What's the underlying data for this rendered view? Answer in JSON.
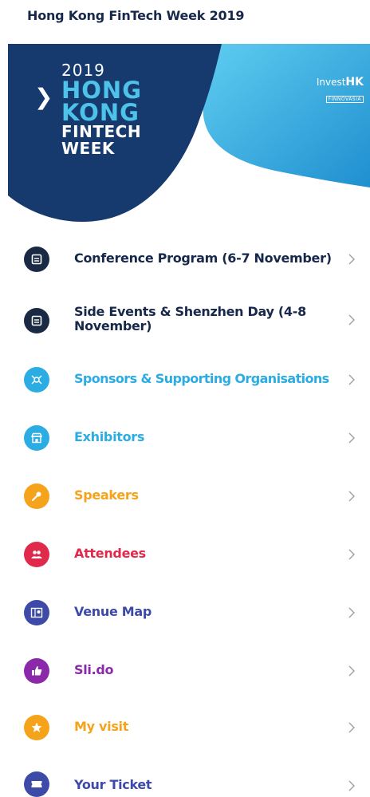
{
  "app_title": "Hong Kong FinTech Week 2019",
  "banner": {
    "year": "2019",
    "line1": "HONG",
    "line2": "KONG",
    "line3": "FINTECH",
    "line4": "WEEK",
    "partner_brand_prefix": "Invest",
    "partner_brand_suffix": "HK",
    "partner_sub": "FINNOVASIA"
  },
  "colors": {
    "navy": "#17284a",
    "dark_icon": "#1b2a44",
    "cyan": "#2bace2",
    "orange": "#f5a31a",
    "red": "#e02a4c",
    "indigo": "#3d4aa8",
    "purple": "#8a2aa8",
    "chevron": "#9aa0a8"
  },
  "menu_items": [
    {
      "label": "Conference Program (6-7 November)",
      "color": "#17284a",
      "icon": "calendar-icon"
    },
    {
      "label": "Side Events & Shenzhen Day (4-8 November)",
      "color": "#17284a",
      "icon": "calendar-icon"
    },
    {
      "label": "Sponsors & Supporting Organisations",
      "color": "#2bace2",
      "icon": "handshake-icon"
    },
    {
      "label": "Exhibitors",
      "color": "#2bace2",
      "icon": "store-icon"
    },
    {
      "label": "Speakers",
      "color": "#f5a31a",
      "icon": "microphone-icon"
    },
    {
      "label": "Attendees",
      "color": "#e02a4c",
      "icon": "people-icon"
    },
    {
      "label": "Venue Map",
      "color": "#3d4aa8",
      "icon": "map-icon"
    },
    {
      "label": "Sli.do",
      "color": "#8a2aa8",
      "icon": "thumbs-up-icon"
    },
    {
      "label": "My visit",
      "color": "#f5a31a",
      "icon": "star-icon"
    },
    {
      "label": "Your Ticket",
      "color": "#3d4aa8",
      "icon": "ticket-icon"
    }
  ]
}
